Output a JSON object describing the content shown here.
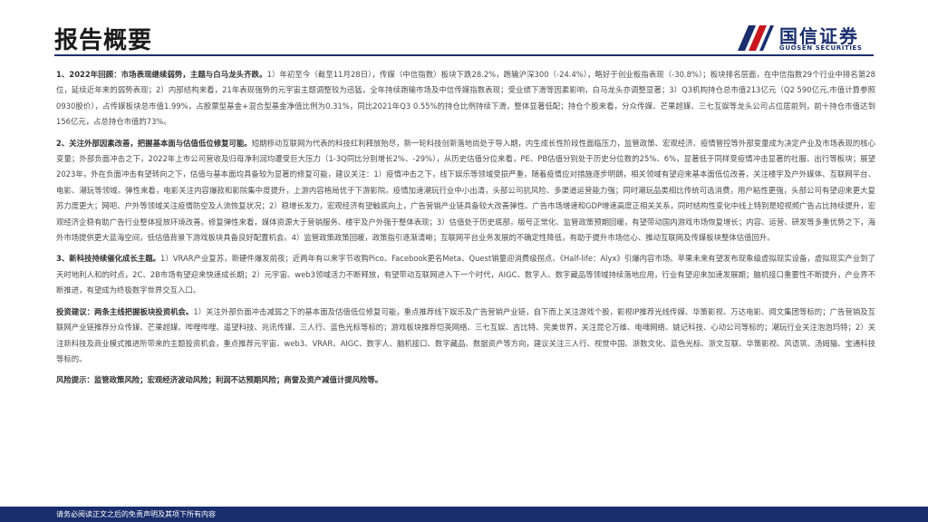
{
  "header": {
    "title": "报告概要",
    "logo_cn": "国信证券",
    "logo_en": "GUOSEN SECURITIES"
  },
  "paragraphs": [
    {
      "lead": "1、2022年回顾：市场表现继续弱势，主题与白马龙头齐跌。",
      "body": "1）年初至今（截至11月28日），传媒（中信指数）板块下跌28.2%，跑输沪深300（-24.4%），略好于创业板指表现（-30.8%）；板块排名层面，在中信指数29个行业中排名第28位，延续近年来的弱势表现；2）内部结构来看，21年表现强势的元宇宙主题调整较为迅猛，全年持续跑输市场及中信传媒指数表现；受业绩下滑等因素影响，白马龙头亦调整显著；3）Q3机构持仓总市值213亿元（Q2 590亿元,市值计算参照0930股价），占传媒板块总市值1.99%，占股票型基金+混合型基金净值比例为0.31%，同比2021年Q3 0.55%的持仓比例持续下滑，整体显著低配；持仓个股来看，分众传媒、芒果超媒、三七互娱等龙头公司占位居前列，前十持仓市值达到156亿元，占总持仓市值的73%。"
    },
    {
      "lead": "2、关注外部因素改善，把握基本面与估值低位修复可能。",
      "body": "短期移动互联网为代表的科技红利释放殆尽，新一轮科技创新落地尚处于导入期，内生成长性阶段性面临压力，监管政策、宏观经济、疫情管控等外部变量成为决定产业及市场表现的核心变量；外部负面冲击之下，2022年上市公司营收及归母净利润均遭受巨大压力（1-3Q同比分别增长2%、-29%），从历史估值分位来看，PE、PB估值分别处于历史分位数的25%、6%，显著低于同样受疫情冲击显著的社服、出行等板块；展望2023年，外在负面冲击有望转向之下，估值与基本面均具备较为显著的修复可能，建议关注：1）疫情冲击之下，线下娱乐等领域受损严重，随着疫情应对措施逐步明朗，相关领域有望迎来基本面低位改善，关注楼宇及户外媒体、互联网平台、电影、潮玩等领域。弹性来看，电影关注内容爆款和影院集中度提升，上游内容格局优于下游影院。疫情加速潮玩行业中小出清，头部公司抗风险、多渠道运营能力强；同时潮玩品类相比传统可选消费，用户粘性更强，头部公司有望迎来更大复苏力度更大；网吧、户外等领域关注疫情防空及人流恢复状况；2）稳增长发力，宏观经济有望触底向上，广告营销产业链具备较大改善弹性。广告市场增速和GDP增速高度正相关关系，同时结构性变化中线上特别是短视频广告占比持续提升，宏观经济企稳有助广告行业整体投放环境改善。修复弹性来看，媒体资源大于营销服务、楼宇及户外强于整体表现；3）估值处于历史底部，版号正常化、监管政策预期回暖，有望带动国内游戏市场恢复增长；内容、运营、研发等多重优势之下，海外市场提供更大蓝海空间，低估值背景下游戏板块具备良好配置机会。4）监管政策政策回暖，政策指引逐渐清晰；互联网平台业务发展的不确定性降低，有助于提升市场信心、推动互联网及传媒板块整体估值回升。"
    },
    {
      "lead": "3、新科技持续催化成长主题。",
      "body": "1）VRAR产业复苏，新硬件爆发前夜；近两年有以来字节收购Pico、Facebook更名Meta、Quest销量迎消费级拐点、《Half-life：Alyx》引爆内容市场、苹果未来有望发布现象级虚拟现实设备，虚拟现实产业到了天时地利人和的时点，2C、2B市场有望迎来快速成长期；2）元宇宙、web3领域活力不断释放，有望带动互联网进入下一个时代，AIGC、数字人、数字藏品等领域持续落地应用，行业有望迎来加速发展期；脑机接口重要性不断提升，产业界不断推进，有望成为终极数字世界交互入口。"
    },
    {
      "lead": "投资建议：两条主线把握板块投资机会。",
      "body": "1）关注外部负面冲击减弱之下的基本面及估值低位修复可能，重点推荐线下娱乐及广告营销产业链，自下而上关注游戏个股，影视IP推荐光线传媒、华策影视、万达电影、阅文集团等标的；广告营销及互联网产业链推荐分众传媒、芒果超媒、哔哩哔哩、遥望科技、兆讯传媒、三人行、蓝色光标等标的；游戏板块推荐恺英网络、三七互娱、吉比特、完美世界，关注昆仑万维、电魂网络、姚记科技、心动公司等标的；潮玩行业关注泡泡玛特；2）关注新科技及商业模式推进所带来的主题投资机会，重点推荐元宇宙、web3、VRAR、AIGC、数字人、脑机接口、数字藏品、数据资产等方向，建议关注三人行、视觉中国、浙数文化、蓝色光标、浙文互联、华策影视、风语筑、汤姆猫、宝通科技等标的。"
    },
    {
      "lead": "风险提示：监管政策风险；宏观经济波动风险；利润不达预期风险；商誉及资产减值计提风险等。",
      "body": ""
    }
  ],
  "footer": {
    "text": "请务必阅读正文之后的免责声明及其项下所有内容"
  },
  "colors": {
    "brand_navy": "#1a2e6e",
    "brand_red": "#c8161d"
  }
}
